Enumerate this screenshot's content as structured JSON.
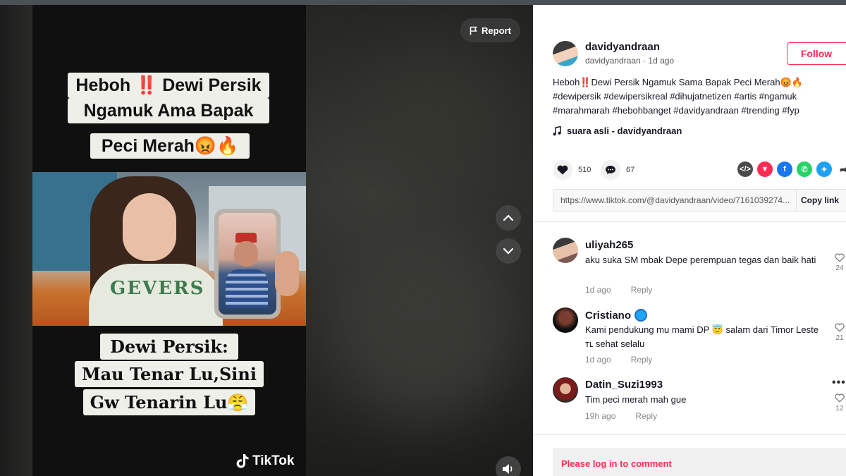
{
  "video": {
    "caption_top_lines": [
      "Heboh ‼️ Dewi Persik",
      "Ngamuk Ama Bapak",
      "Peci Merah😡🔥"
    ],
    "caption_bottom_lines": [
      "Dewi Persik:",
      "Mau Tenar Lu,Sini",
      "Gw Tenarin Lu😤"
    ],
    "shirt_text": "GEVERS",
    "watermark": "TikTok",
    "report_label": "Report"
  },
  "author": {
    "name": "davidyandraan",
    "subline": "davidyandraan · 1d ago",
    "follow_label": "Follow"
  },
  "description": {
    "text": "Heboh‼️Dewi Persik Ngamuk Sama Bapak Peci Merah😡🔥",
    "hashtags": "#dewipersik #dewipersikreal #dihujatnetizen #artis #ngamuk #marahmarah #hebohbanget #davidyandraan #trending #fyp"
  },
  "music": {
    "label": "suara asli - davidyandraan",
    "icon": "music-note-icon"
  },
  "stats": {
    "likes": "510",
    "comments": "67"
  },
  "share_icons": [
    {
      "name": "embed-icon",
      "color": "#4b4b4b"
    },
    {
      "name": "send-icon",
      "color": "#fe2c55"
    },
    {
      "name": "facebook-icon",
      "color": "#1877f2"
    },
    {
      "name": "whatsapp-icon",
      "color": "#25d366"
    },
    {
      "name": "twitter-icon",
      "color": "#1da1f2"
    }
  ],
  "link": {
    "url": "https://www.tiktok.com/@davidyandraan/video/7161039274...",
    "copy_label": "Copy link"
  },
  "comments": [
    {
      "user": "uliyah265",
      "text": "aku suka SM mbak Depe perempuan tegas dan baik hati",
      "time": "1d ago",
      "reply": "Reply",
      "likes": "24",
      "verified": false
    },
    {
      "user": "Cristiano",
      "text": "Kami pendukung mu mami DP 😇 salam dari Timor Leste ᴛʟ sehat selalu",
      "time": "1d ago",
      "reply": "Reply",
      "likes": "21",
      "verified": true
    },
    {
      "user": "Datin_Suzi1993",
      "text": "Tim peci merah mah gue",
      "time": "19h ago",
      "reply": "Reply",
      "likes": "12",
      "verified": false
    }
  ],
  "login_prompt": "Please log in to comment",
  "colors": {
    "accent": "#fe2c55",
    "panel_bg": "#ffffff",
    "video_bg": "#1d1e1c"
  }
}
